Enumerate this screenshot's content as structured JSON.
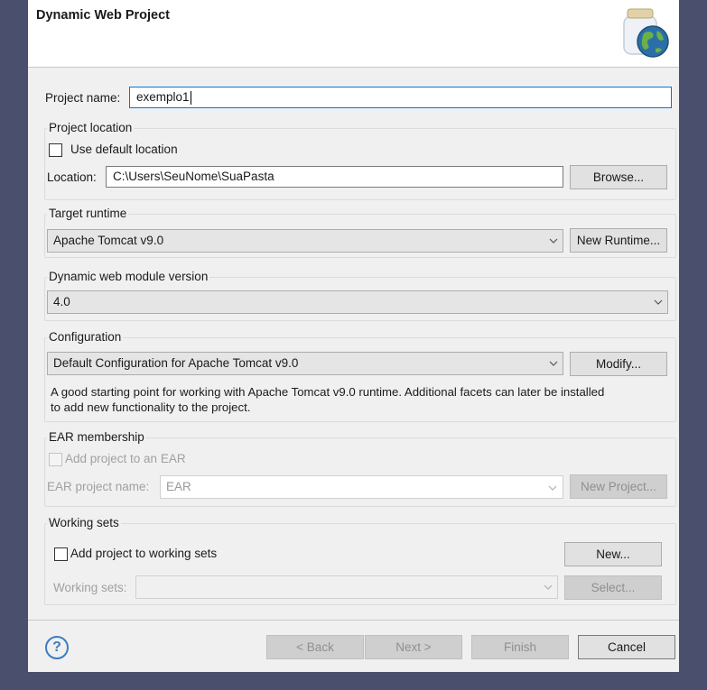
{
  "banner": {
    "title": "Dynamic Web Project",
    "icon": "web-project-jar-globe-icon"
  },
  "project_name": {
    "label": "Project name:",
    "value": "exemplo1"
  },
  "location_group": {
    "title": "Project location",
    "use_default": {
      "label": "Use default location",
      "checked": false
    },
    "location_label": "Location:",
    "location_value": "C:\\Users\\SeuNome\\SuaPasta",
    "browse": "Browse..."
  },
  "runtime_group": {
    "title": "Target runtime",
    "selected": "Apache Tomcat v9.0",
    "new_runtime": "New Runtime..."
  },
  "module_group": {
    "title": "Dynamic web module version",
    "selected": "4.0"
  },
  "config_group": {
    "title": "Configuration",
    "selected": "Default Configuration for Apache Tomcat v9.0",
    "modify": "Modify...",
    "description_line1": "A good starting point for working with Apache Tomcat v9.0 runtime. Additional facets can later be installed",
    "description_line2": "to add new functionality to the project."
  },
  "ear_group": {
    "title": "EAR membership",
    "add_to_ear": {
      "label": "Add project to an EAR",
      "checked": false
    },
    "ear_name_label": "EAR project name:",
    "ear_name_value": "EAR",
    "new_project": "New Project..."
  },
  "working_sets_group": {
    "title": "Working sets",
    "add_to_sets": {
      "label": "Add project to working sets",
      "checked": false
    },
    "new": "New...",
    "sets_label": "Working sets:",
    "sets_value": "",
    "select": "Select..."
  },
  "footer": {
    "back": "< Back",
    "next": "Next >",
    "finish": "Finish",
    "cancel": "Cancel",
    "help_glyph": "?"
  },
  "colors": {
    "focus_border": "#0078d7",
    "help_blue": "#3b7dc0",
    "window_bg": "#f0f0f0"
  }
}
